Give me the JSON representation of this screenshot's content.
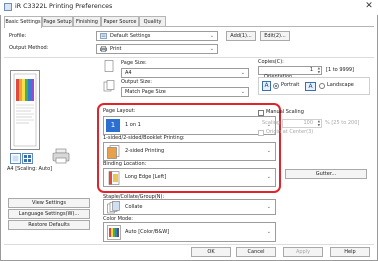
{
  "window": {
    "title": "iR C3322L Printing Preferences",
    "close_glyph": "✕"
  },
  "tabs": [
    {
      "label": "Basic Settings",
      "active": true
    },
    {
      "label": "Page Setup",
      "active": false
    },
    {
      "label": "Finishing",
      "active": false
    },
    {
      "label": "Paper Source",
      "active": false
    },
    {
      "label": "Quality",
      "active": false
    }
  ],
  "profile": {
    "label": "Profile:",
    "value": "Default Settings",
    "add_label": "Add(1)...",
    "edit_label": "Edit(2)..."
  },
  "output_method": {
    "label": "Output Method:",
    "value": "Print"
  },
  "page_size": {
    "label": "Page Size:",
    "value": "A4"
  },
  "output_size": {
    "label": "Output Size:",
    "value": "Match Page Size"
  },
  "copies": {
    "label": "Copies(C):",
    "value": "1",
    "range": "[1 to 9999]"
  },
  "orientation": {
    "label": "Orientation",
    "portrait_icon": "A",
    "portrait_label": "Portrait",
    "landscape_icon": "A",
    "landscape_label": "Landscape",
    "selected": "Portrait"
  },
  "page_layout": {
    "label": "Page Layout:",
    "value": "1 on 1",
    "icon_number": "1"
  },
  "printing_mode": {
    "label": "1-sided/2-sided/Booklet Printing:",
    "value": "2-sided Printing"
  },
  "binding_location": {
    "label": "Binding Location:",
    "value": "Long Edge [Left]"
  },
  "manual_scaling": {
    "label": "Manual Scaling",
    "scaling_label": "Scaling:",
    "scaling_value": "100",
    "scaling_range": "% [25 to 200]",
    "origin_label": "Origin at Center(3)"
  },
  "gutter_button": "Gutter...",
  "staple_group": {
    "label": "Staple/Collate/Group(N):",
    "value": "Collate"
  },
  "color_mode": {
    "label": "Color Mode:",
    "value": "Auto [Color/B&W]"
  },
  "preview": {
    "caption": "A4 [Scaling: Auto]"
  },
  "left_buttons": {
    "view_settings": "View Settings",
    "language_settings": "Language Settings(W)...",
    "restore_defaults": "Restore Defaults"
  },
  "footer": {
    "ok": "OK",
    "cancel": "Cancel",
    "apply": "Apply",
    "help": "Help"
  },
  "colors": {
    "highlight": "#e0242c",
    "accent": "#1f6fd1"
  }
}
